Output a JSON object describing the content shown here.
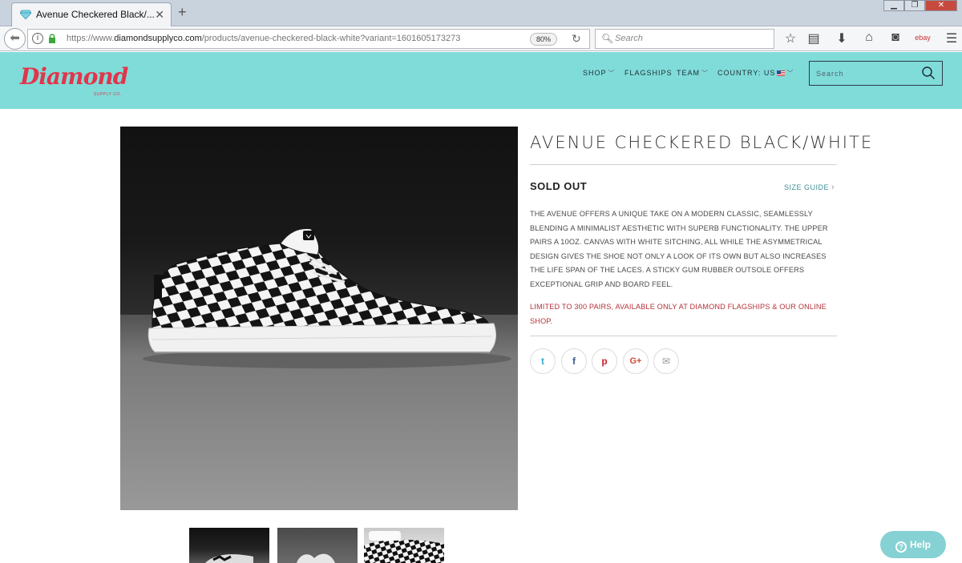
{
  "browser": {
    "tab_title": "Avenue Checkered Black/...",
    "tab_close": "✕",
    "new_tab": "+",
    "window_controls": [
      "▁",
      "❐",
      "✕"
    ],
    "url_prefix": "https://www.",
    "url_domain": "diamondsupplyco.com",
    "url_path": "/products/avenue-checkered-black-white?variant=1601605173273",
    "zoom": "80%",
    "search_placeholder": "Search"
  },
  "header": {
    "logo": "Diamond",
    "logo_sub": "SUPPLY CO.",
    "nav": {
      "shop": "SHOP",
      "flagships": "FLAGSHIPS",
      "team": "TEAM",
      "country": "COUNTRY: US"
    },
    "search_placeholder": "Search"
  },
  "product": {
    "title": "AVENUE CHECKERED BLACK/WHITE",
    "status": "SOLD OUT",
    "size_guide": "SIZE GUIDE",
    "description": "THE AVENUE OFFERS A UNIQUE TAKE ON A MODERN CLASSIC, SEAMLESSLY BLENDING A MINIMALIST AESTHETIC WITH SUPERB FUNCTIONALITY. THE UPPER PAIRS A 10OZ. CANVAS WITH WHITE SITCHING, ALL WHILE THE ASYMMETRICAL DESIGN GIVES THE SHOE NOT ONLY A LOOK OF ITS OWN BUT ALSO INCREASES THE LIFE SPAN OF THE LACES. A STICKY GUM RUBBER OUTSOLE OFFERS EXCEPTIONAL GRIP AND BOARD FEEL.",
    "notice": "LIMITED TO 300 PAIRS, AVAILABLE ONLY AT DIAMOND FLAGSHIPS & OUR ONLINE SHOP."
  },
  "share": {
    "twitter": "t",
    "facebook": "f",
    "pinterest": "p",
    "google": "G+",
    "email": "✉"
  },
  "help": {
    "label": "Help"
  },
  "colors": {
    "header_bg": "#80dcd8",
    "brand_red": "#e1354b",
    "notice_red": "#b4323b",
    "link_teal": "#3b8f95",
    "help_bg": "#86d1d3"
  }
}
